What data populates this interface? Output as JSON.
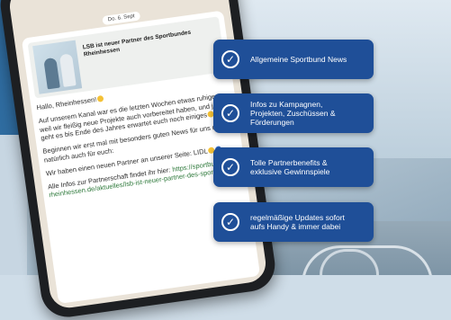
{
  "chat": {
    "date": "Do. 6. Sept",
    "link_preview_title": "LSB ist neuer Partner des Sportbundes Rheinhessen",
    "paragraphs": [
      "Hallo, Rheinhessen!",
      "Auf unserem Kanal war es die letzten Wochen etwas ruhiger, weil wir fleißig neue Projekte auch vorbereitet haben, und jetzt geht es bis Ende des Jahres erwartet euch noch einiges",
      "Beginnen wir erst mal mit besonders guten News für uns und natürlich auch für euch:",
      "Wir haben einen neuen Partner an unserer Seite: LIDL",
      "Alle Infos zur Partnerschaft findet ihr hier:"
    ],
    "link_text": "https://sportbund-rheinhessen.de/aktuelles/lsb-ist-neuer-partner-des-sportbundes"
  },
  "features": [
    {
      "label": "Allgemeine Sportbund News",
      "icon": "check-circle-icon"
    },
    {
      "label": "Infos zu Kampagnen, Projekten, Zuschüssen & Förderungen",
      "icon": "check-circle-icon"
    },
    {
      "label": "Tolle Partnerbenefits & exklusive Gewinnspiele",
      "icon": "check-circle-icon"
    },
    {
      "label": "regelmäßige Updates sofort aufs Handy & immer dabei",
      "icon": "check-circle-icon"
    }
  ],
  "colors": {
    "accent": "#1f4f98",
    "chat_bg": "#eae3d8",
    "link": "#2f7a3c"
  }
}
